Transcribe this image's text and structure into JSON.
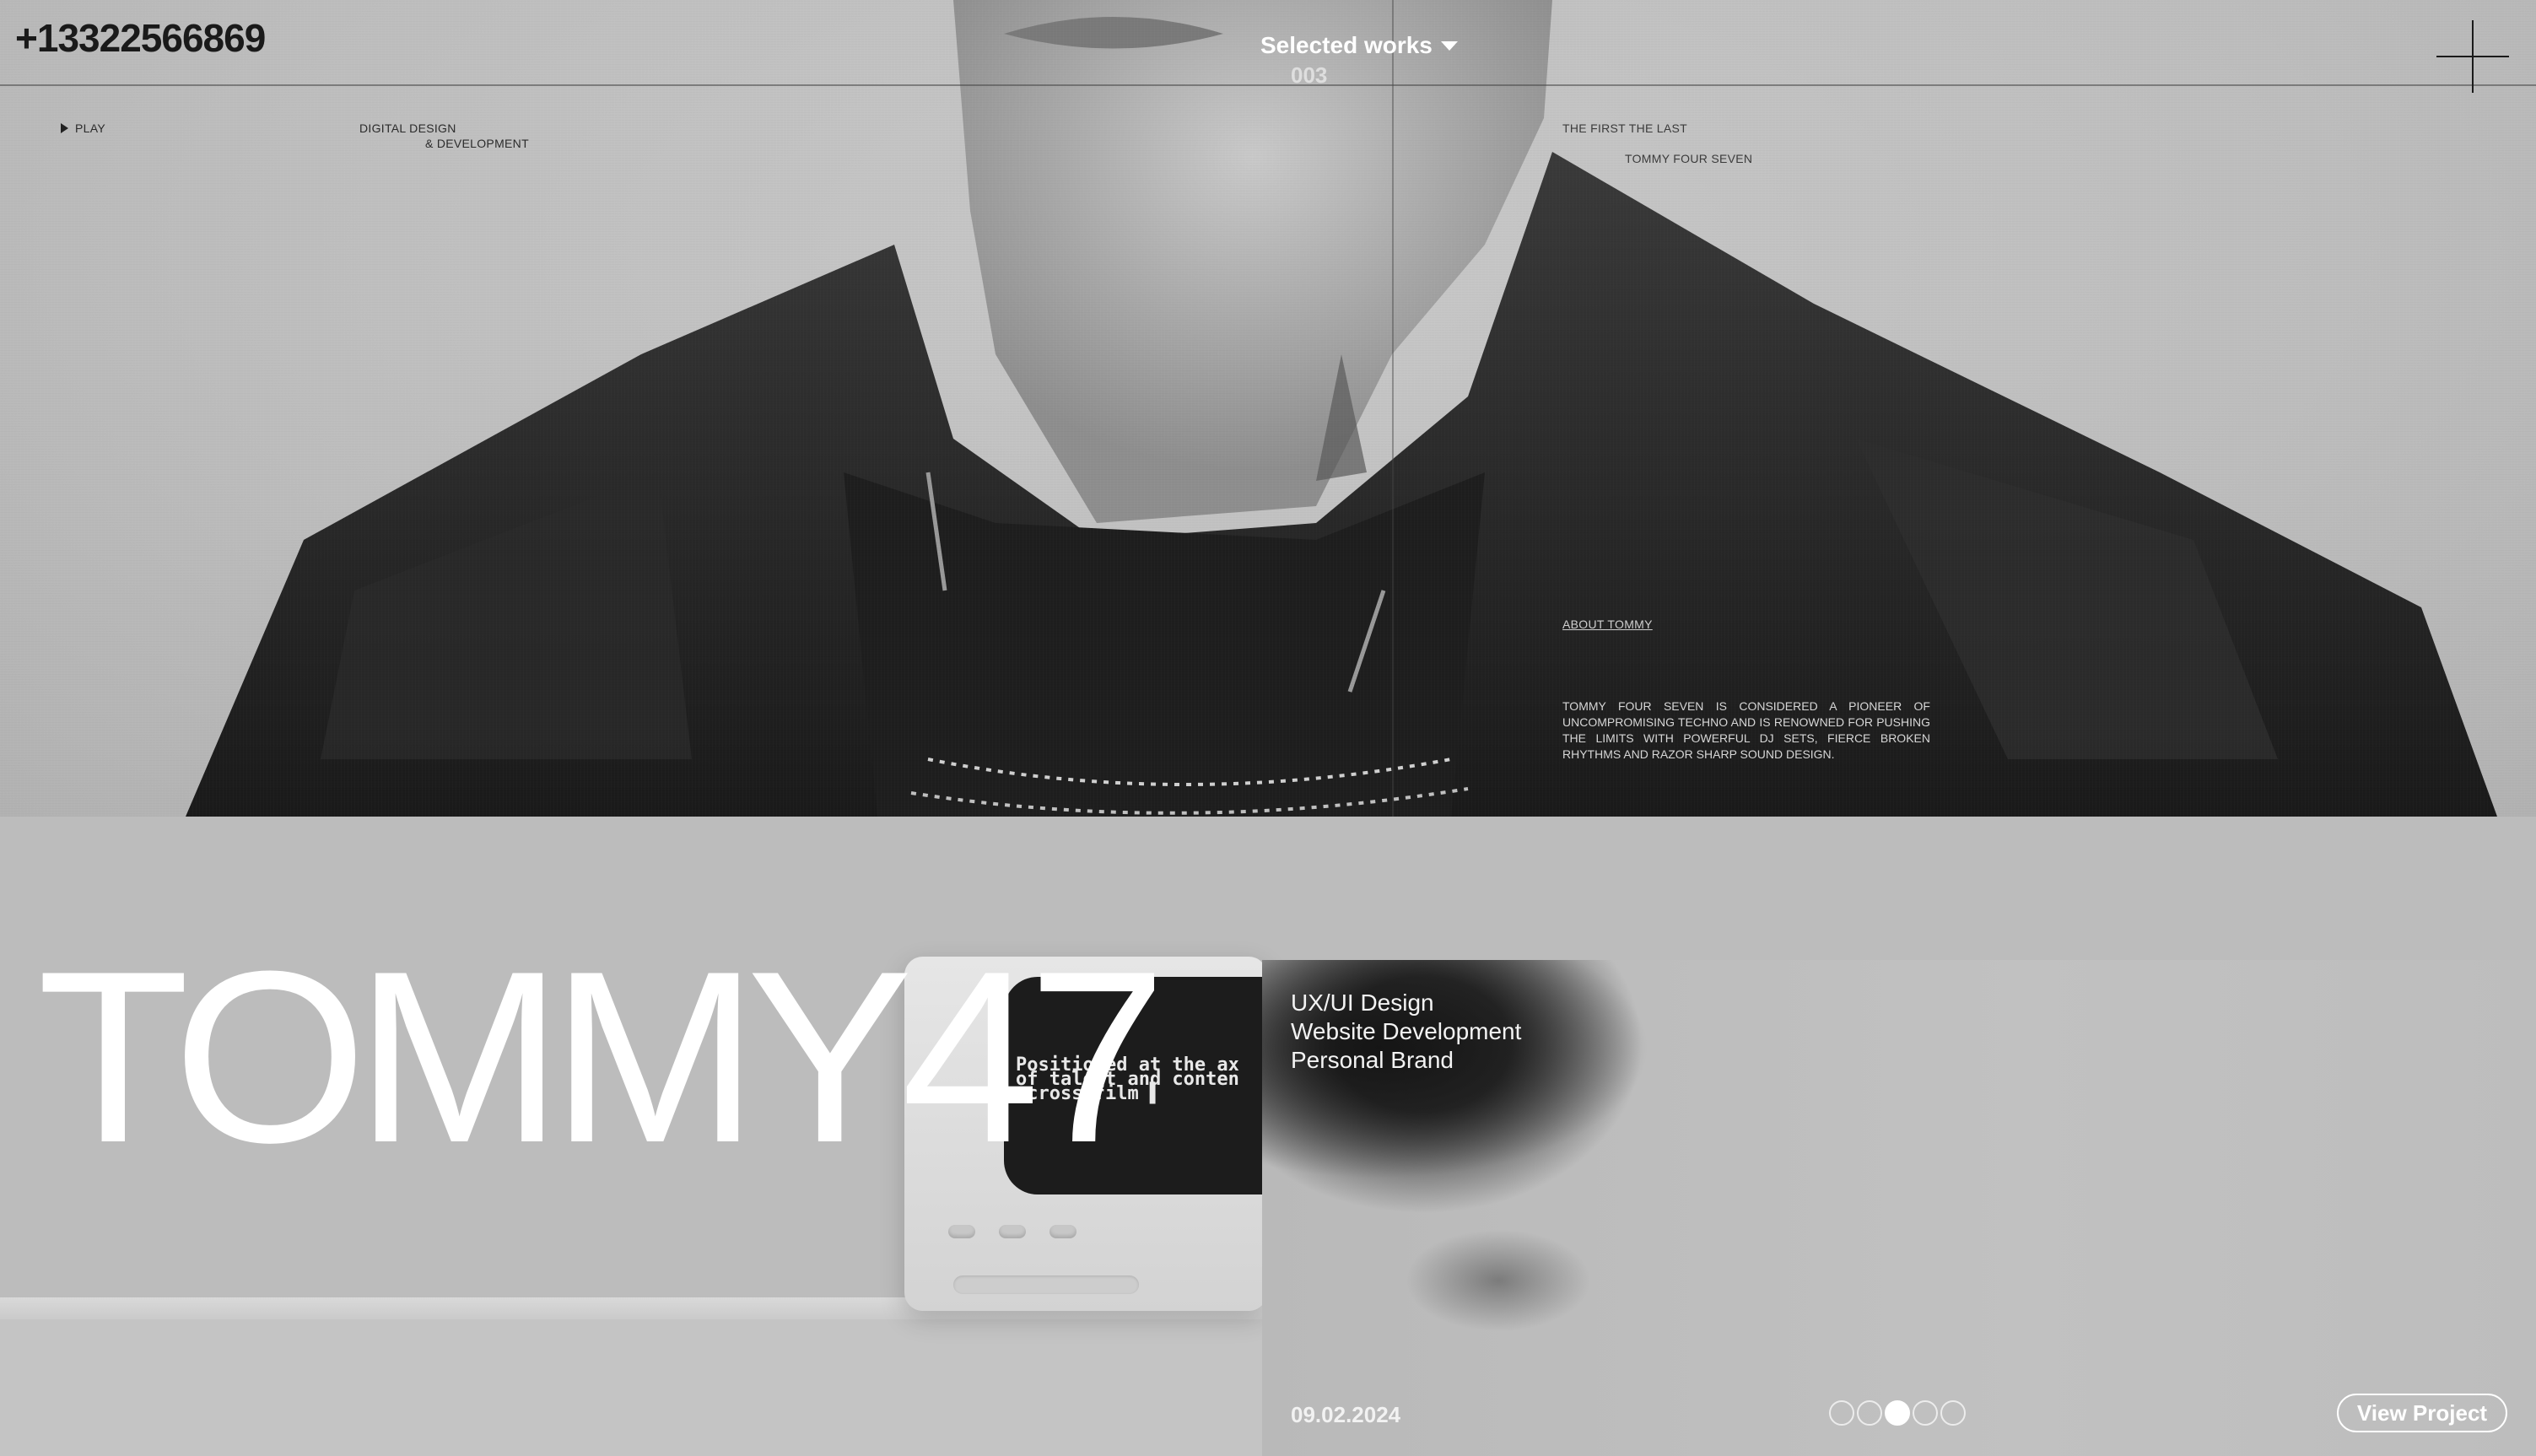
{
  "header": {
    "phone": "+13322566869",
    "nav_label": "Selected works",
    "index": "003",
    "menu_icon": "plus-icon"
  },
  "hero": {
    "play_label": "PLAY",
    "discipline_line1": "DIGITAL DESIGN",
    "discipline_line2": "& DEVELOPMENT",
    "tagline_line1": "THE FIRST THE LAST",
    "tagline_line2": "TOMMY FOUR SEVEN",
    "about_link": "ABOUT TOMMY",
    "about_text": "TOMMY FOUR SEVEN IS CONSIDERED A PIONEER OF UNCOMPROMISING TECHNO AND IS RENOWNED FOR PUSHING THE LIMITS WITH POWERFUL DJ SETS, FIERCE BROKEN RHYTHMS AND RAZOR SHARP SOUND DESIGN."
  },
  "project": {
    "title": "TOMMY47",
    "services": [
      "UX/UI Design",
      "Website Development",
      "Personal Brand"
    ],
    "screen_text": "Positioned at the ax\nof talent and conten\nacross film ▌",
    "date": "09.02.2024",
    "view_button": "View Project",
    "slides_total": 5,
    "slide_active": 3
  },
  "colors": {
    "background": "#bdbdbd",
    "text_light": "#ffffff",
    "text_dark": "#1a1a1a"
  }
}
